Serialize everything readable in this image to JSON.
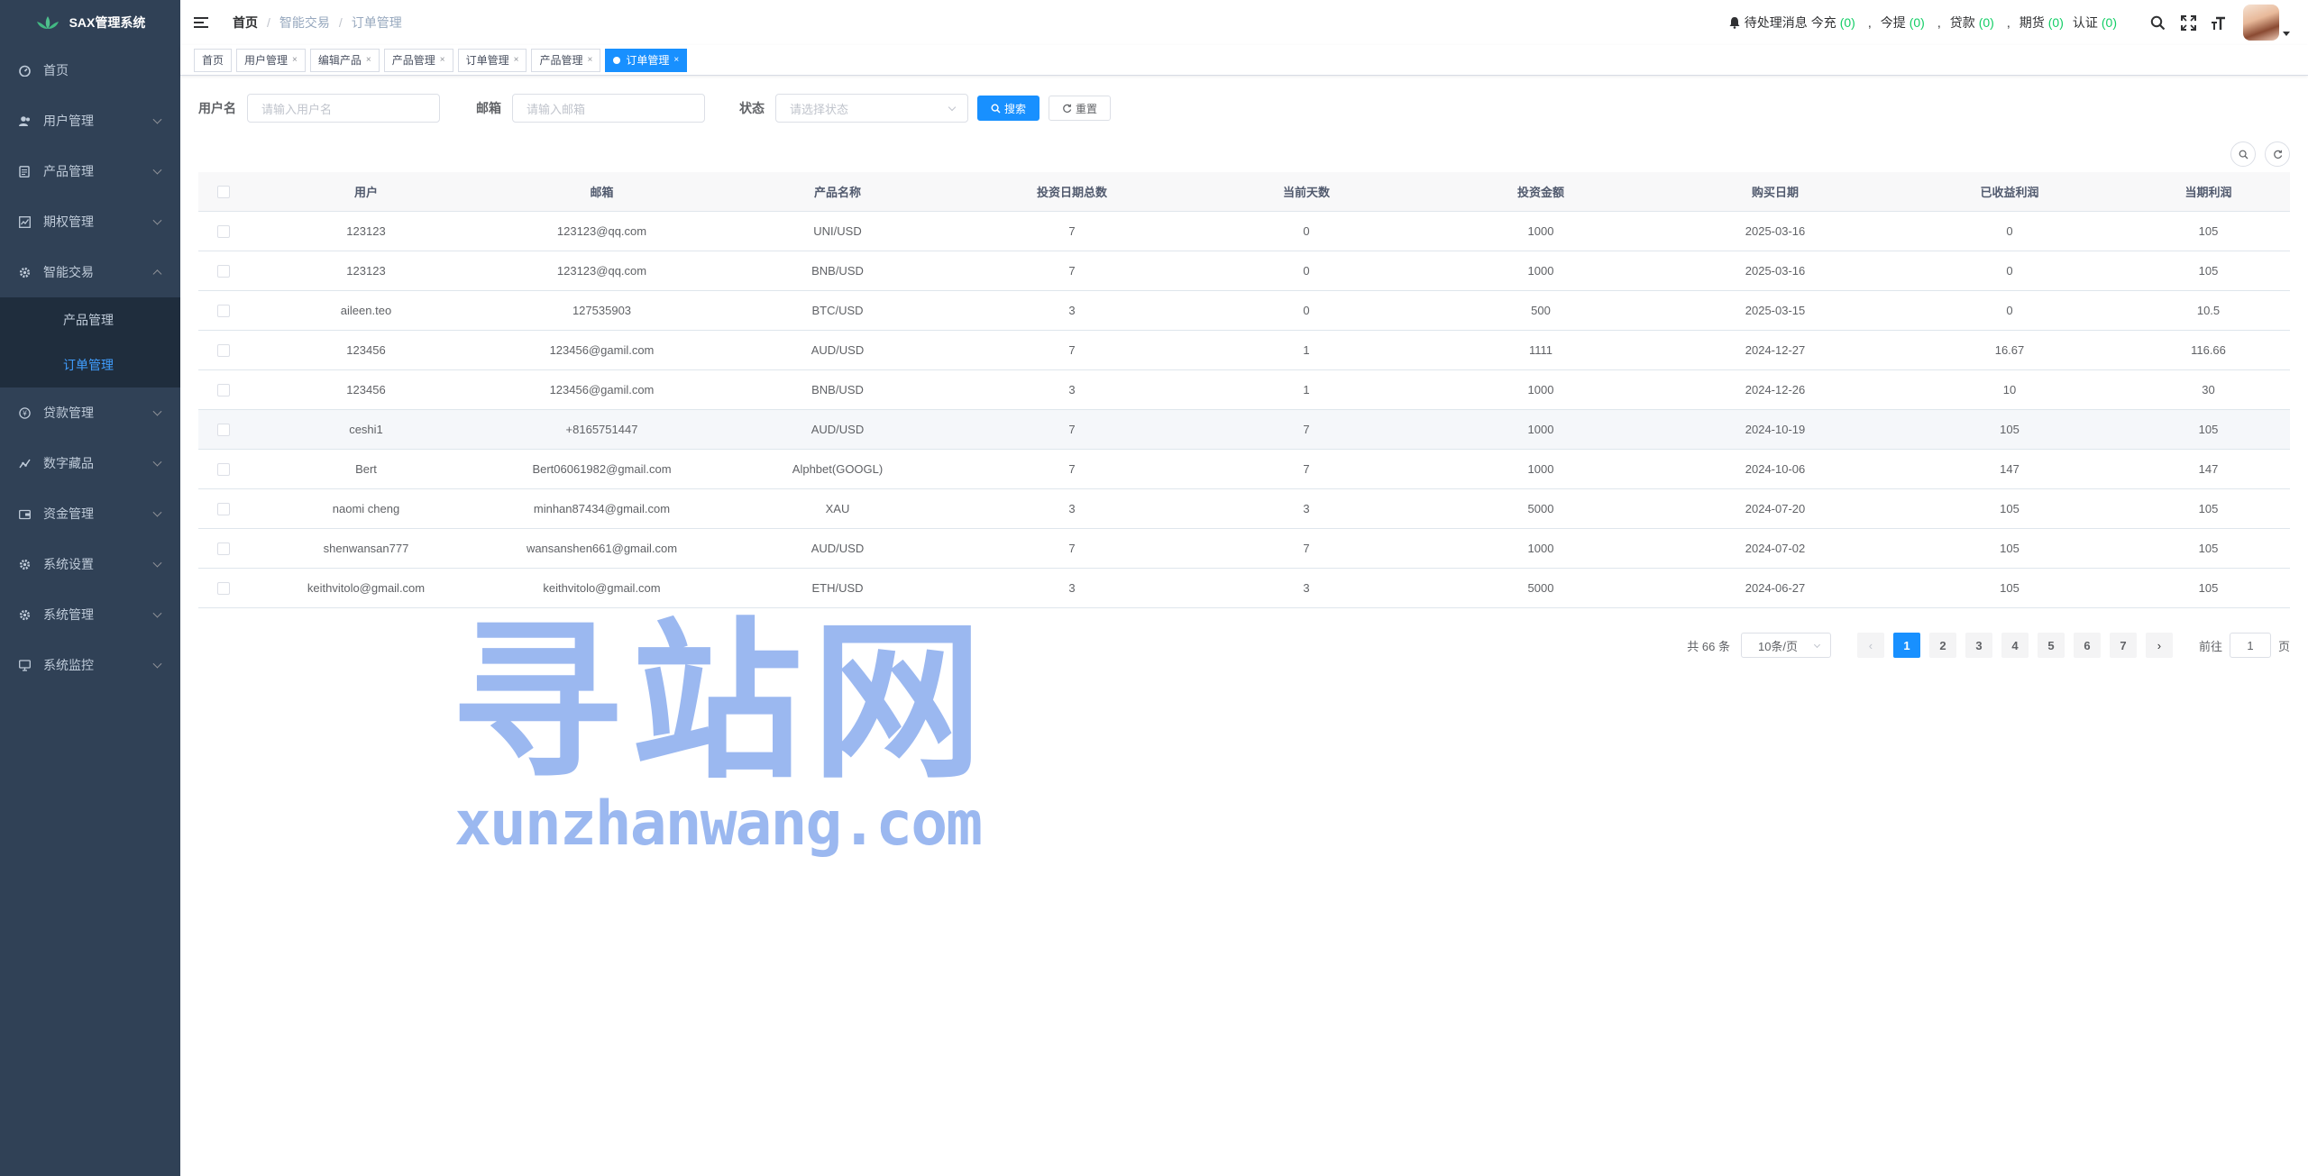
{
  "app": {
    "title": "SAX管理系统"
  },
  "sidebar": {
    "items": [
      {
        "label": "首页",
        "icon": "dashboard-icon"
      },
      {
        "label": "用户管理",
        "icon": "user-icon"
      },
      {
        "label": "产品管理",
        "icon": "document-icon"
      },
      {
        "label": "期权管理",
        "icon": "chart-icon"
      },
      {
        "label": "智能交易",
        "icon": "gear-icon",
        "expanded": true
      },
      {
        "label": "贷款管理",
        "icon": "money-icon"
      },
      {
        "label": "数字藏品",
        "icon": "trend-icon"
      },
      {
        "label": "资金管理",
        "icon": "wallet-icon"
      },
      {
        "label": "系统设置",
        "icon": "gear-icon"
      },
      {
        "label": "系统管理",
        "icon": "gear-icon"
      },
      {
        "label": "系统监控",
        "icon": "monitor-icon"
      }
    ],
    "submenu": [
      {
        "label": "产品管理"
      },
      {
        "label": "订单管理",
        "active": true
      }
    ]
  },
  "breadcrumb": [
    "首页",
    "智能交易",
    "订单管理"
  ],
  "notifications": {
    "prefix": "待处理消息",
    "items": [
      {
        "label": "今充",
        "count": "(0)"
      },
      {
        "label": "今提",
        "count": "(0)"
      },
      {
        "label": "贷款",
        "count": "(0)"
      },
      {
        "label": "期货",
        "count": "(0)"
      },
      {
        "label": "认证",
        "count": "(0)"
      }
    ],
    "separator": ","
  },
  "tags": [
    {
      "label": "首页",
      "closable": false
    },
    {
      "label": "用户管理",
      "closable": true
    },
    {
      "label": "编辑产品",
      "closable": true
    },
    {
      "label": "产品管理",
      "closable": true
    },
    {
      "label": "订单管理",
      "closable": true
    },
    {
      "label": "产品管理",
      "closable": true
    },
    {
      "label": "订单管理",
      "closable": true,
      "active": true
    }
  ],
  "search": {
    "username_label": "用户名",
    "username_placeholder": "请输入用户名",
    "email_label": "邮箱",
    "email_placeholder": "请输入邮箱",
    "status_label": "状态",
    "status_placeholder": "请选择状态",
    "search_button": "搜索",
    "reset_button": "重置"
  },
  "table": {
    "columns": [
      "用户",
      "邮箱",
      "产品名称",
      "投资日期总数",
      "当前天数",
      "投资金额",
      "购买日期",
      "已收益利润",
      "当期利润"
    ],
    "rows": [
      [
        "123123",
        "123123@qq.com",
        "UNI/USD",
        "7",
        "0",
        "1000",
        "2025-03-16",
        "0",
        "105"
      ],
      [
        "123123",
        "123123@qq.com",
        "BNB/USD",
        "7",
        "0",
        "1000",
        "2025-03-16",
        "0",
        "105"
      ],
      [
        "aileen.teo",
        "127535903",
        "BTC/USD",
        "3",
        "0",
        "500",
        "2025-03-15",
        "0",
        "10.5"
      ],
      [
        "123456",
        "123456@gamil.com",
        "AUD/USD",
        "7",
        "1",
        "1111",
        "2024-12-27",
        "16.67",
        "116.66"
      ],
      [
        "123456",
        "123456@gamil.com",
        "BNB/USD",
        "3",
        "1",
        "1000",
        "2024-12-26",
        "10",
        "30"
      ],
      [
        "ceshi1",
        "+8165751447",
        "AUD/USD",
        "7",
        "7",
        "1000",
        "2024-10-19",
        "105",
        "105"
      ],
      [
        "Bert",
        "Bert06061982@gmail.com",
        "Alphbet(GOOGL)",
        "7",
        "7",
        "1000",
        "2024-10-06",
        "147",
        "147"
      ],
      [
        "naomi cheng",
        "minhan87434@gmail.com",
        "XAU",
        "3",
        "3",
        "5000",
        "2024-07-20",
        "105",
        "105"
      ],
      [
        "shenwansan777",
        "wansanshen661@gmail.com",
        "AUD/USD",
        "7",
        "7",
        "1000",
        "2024-07-02",
        "105",
        "105"
      ],
      [
        "keithvitolo@gmail.com",
        "keithvitolo@gmail.com",
        "ETH/USD",
        "3",
        "3",
        "5000",
        "2024-06-27",
        "105",
        "105"
      ]
    ]
  },
  "pagination": {
    "total": "共 66 条",
    "page_size": "10条/页",
    "pages": [
      "1",
      "2",
      "3",
      "4",
      "5",
      "6",
      "7"
    ],
    "current": "1",
    "goto_prefix": "前往",
    "goto_value": "1",
    "goto_suffix": "页"
  },
  "watermark": {
    "cn": "寻站网",
    "en": "xunzhanwang.com"
  },
  "colors": {
    "sidebar_bg": "#304156",
    "submenu_bg": "#1f2d3d",
    "primary": "#1890ff",
    "success": "#13ce66"
  }
}
